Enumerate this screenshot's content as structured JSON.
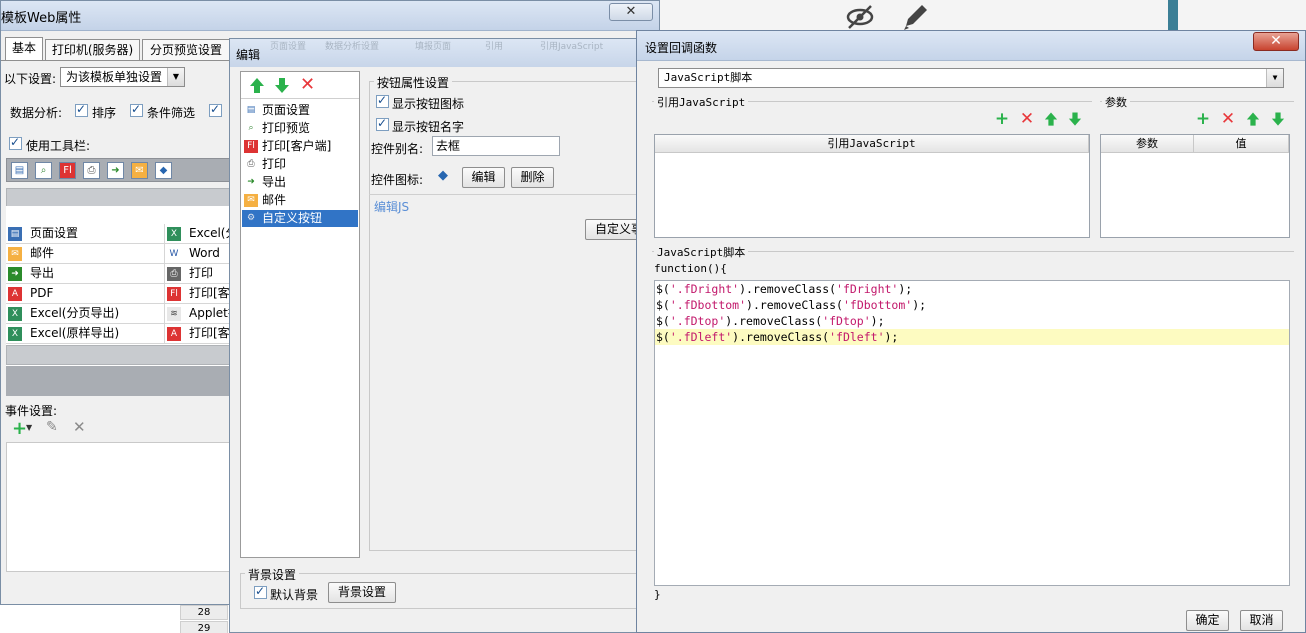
{
  "window_main": {
    "title": "模板Web属性",
    "close": "✕",
    "tabs": [
      "基本",
      "打印机(服务器)",
      "分页预览设置"
    ],
    "settings_label": "以下设置:",
    "settings_value": "为该模板单独设置",
    "data_analysis_label": "数据分析:",
    "sort_label": "排序",
    "filter_label": "条件筛选",
    "use_toolbar_label": "使用工具栏:",
    "toolbar_items": {
      "col1": [
        "页面设置",
        "邮件",
        "导出",
        "PDF",
        "Excel(分页导出)",
        "Excel(原样导出)"
      ],
      "col2": [
        "Excel(分",
        "Word",
        "打印",
        "打印[客",
        "Applet打",
        "打印[客"
      ]
    },
    "event_label": "事件设置:"
  },
  "window_edit": {
    "title": "编辑",
    "ghost_tabs": [
      "页面设置",
      "数据分析设置",
      "填报页面",
      "引用",
      "引用JavaScript"
    ],
    "tree_items": [
      "页面设置",
      "打印预览",
      "打印[客户端]",
      "打印",
      "导出",
      "邮件",
      "自定义按钮"
    ],
    "button_props_title": "按钮属性设置",
    "show_icon_label": "显示按钮图标",
    "show_name_label": "显示按钮名字",
    "alias_label": "控件别名:",
    "alias_value": "去框",
    "icon_label": "控件图标:",
    "edit_btn": "编辑",
    "delete_btn": "删除",
    "edit_js_label": "编辑JS",
    "custom_btn": "自定义事",
    "bg_settings_title": "背景设置",
    "default_bg_label": "默认背景",
    "bg_settings_btn": "背景设置"
  },
  "window_callback": {
    "title": "设置回调函数",
    "close": "✕",
    "type_value": "JavaScript脚本",
    "ref_js_title": "引用JavaScript",
    "ref_js_col": "引用JavaScript",
    "param_title": "参数",
    "param_col1": "参数",
    "param_col2": "值",
    "js_script_title": "JavaScript脚本",
    "fn_open": "function(){",
    "code_lines": [
      {
        "pre": "$(",
        "str1": "'.fDright'",
        "mid": ").removeClass(",
        "str2": "'fDright'",
        "post": ");"
      },
      {
        "pre": "$(",
        "str1": "'.fDbottom'",
        "mid": ").removeClass(",
        "str2": "'fDbottom'",
        "post": ");"
      },
      {
        "pre": "$(",
        "str1": "'.fDtop'",
        "mid": ").removeClass(",
        "str2": "'fDtop'",
        "post": ");"
      },
      {
        "pre": "$(",
        "str1": "'.fDleft'",
        "mid": ").removeClass(",
        "str2": "'fDleft'",
        "post": ");"
      }
    ],
    "fn_close": "}",
    "ok_btn": "确定",
    "cancel_btn": "取消"
  },
  "background": {
    "row_numbers": [
      "28",
      "29"
    ]
  }
}
